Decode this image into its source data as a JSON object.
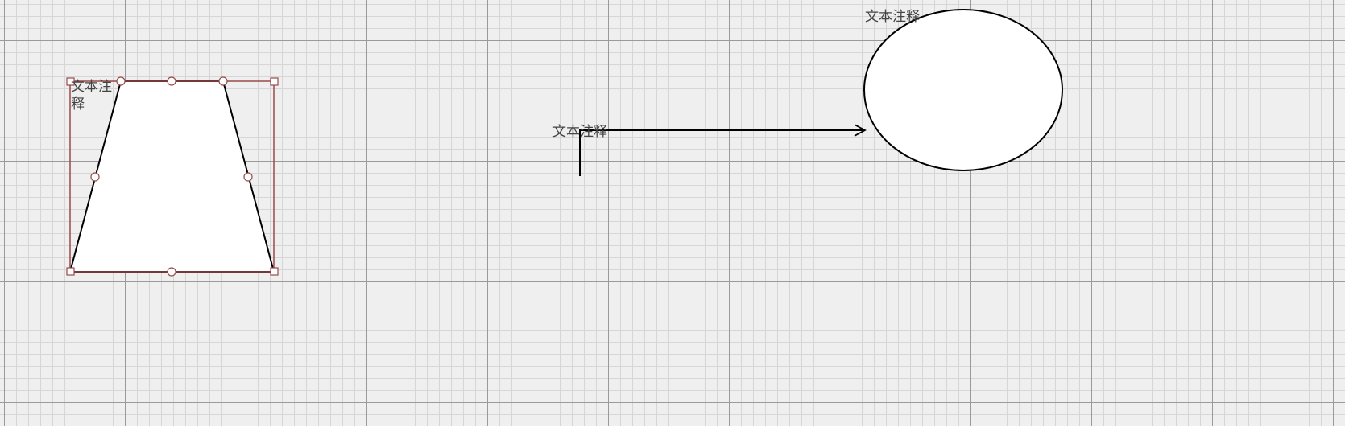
{
  "diagram": {
    "annotations": {
      "trapezoid": "文本注释",
      "connector": "文本注释",
      "ellipse": "文本注释"
    },
    "shapes": [
      {
        "kind": "trapezoid",
        "selected": true
      },
      {
        "kind": "ellipse",
        "selected": false
      }
    ],
    "connector": {
      "kind": "elbow-arrow",
      "end": "open-arrow"
    }
  },
  "colors": {
    "canvas_bg": "#efefef",
    "grid_major": "#9a9a9a",
    "grid_minor": "#d6d6d6",
    "shape_fill": "#ffffff",
    "shape_stroke": "#000000",
    "selection": "#9a4a4a"
  }
}
